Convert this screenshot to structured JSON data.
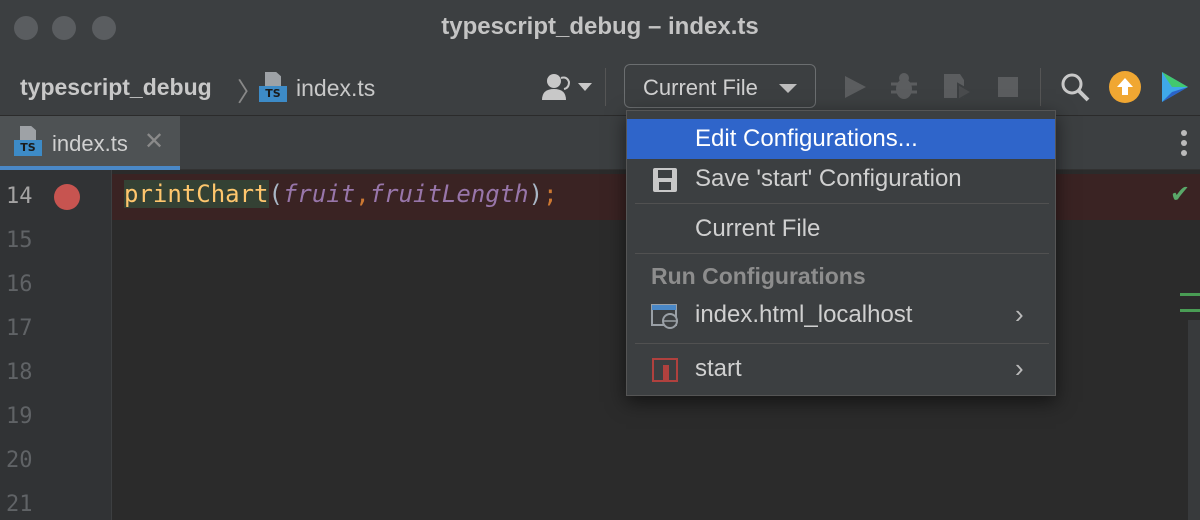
{
  "window": {
    "title": "typescript_debug – index.ts"
  },
  "breadcrumb": {
    "project": "typescript_debug",
    "separator": "〉",
    "file": "index.ts",
    "file_icon_badge": "TS"
  },
  "toolbar": {
    "run_config_label": "Current File",
    "icons": [
      "user-icon",
      "run-icon",
      "debug-icon",
      "coverage-icon",
      "stop-icon",
      "search-icon",
      "update-icon",
      "jetbrains-icon"
    ]
  },
  "tabs": [
    {
      "label": "index.ts",
      "badge": "TS",
      "close": "✕"
    }
  ],
  "editor": {
    "line_numbers": [
      "14",
      "15",
      "16",
      "17",
      "18",
      "19",
      "20",
      "21"
    ],
    "code_line": {
      "fn": "printChart",
      "open": "(",
      "arg1": "fruit",
      "comma": ",",
      "arg2": "fruitLength",
      "close": ")",
      "semi": ";"
    },
    "status_check": "✔"
  },
  "menu": {
    "items": [
      {
        "label": "Edit Configurations...",
        "selected": true
      },
      {
        "label": "Save 'start' Configuration",
        "icon": "save-icon"
      },
      {
        "label": "Current File"
      }
    ],
    "section_header": "Run Configurations",
    "configs": [
      {
        "label": "index.html_localhost",
        "icon": "web-config-icon",
        "arrow": "›"
      },
      {
        "label": "start",
        "icon": "npm-config-icon",
        "arrow": "›"
      }
    ]
  },
  "colors": {
    "background": "#2b2b2b",
    "panel": "#3c3f41",
    "selection": "#2f65ca",
    "breakpoint": "#c75450",
    "update_badge": "#f0a732"
  }
}
